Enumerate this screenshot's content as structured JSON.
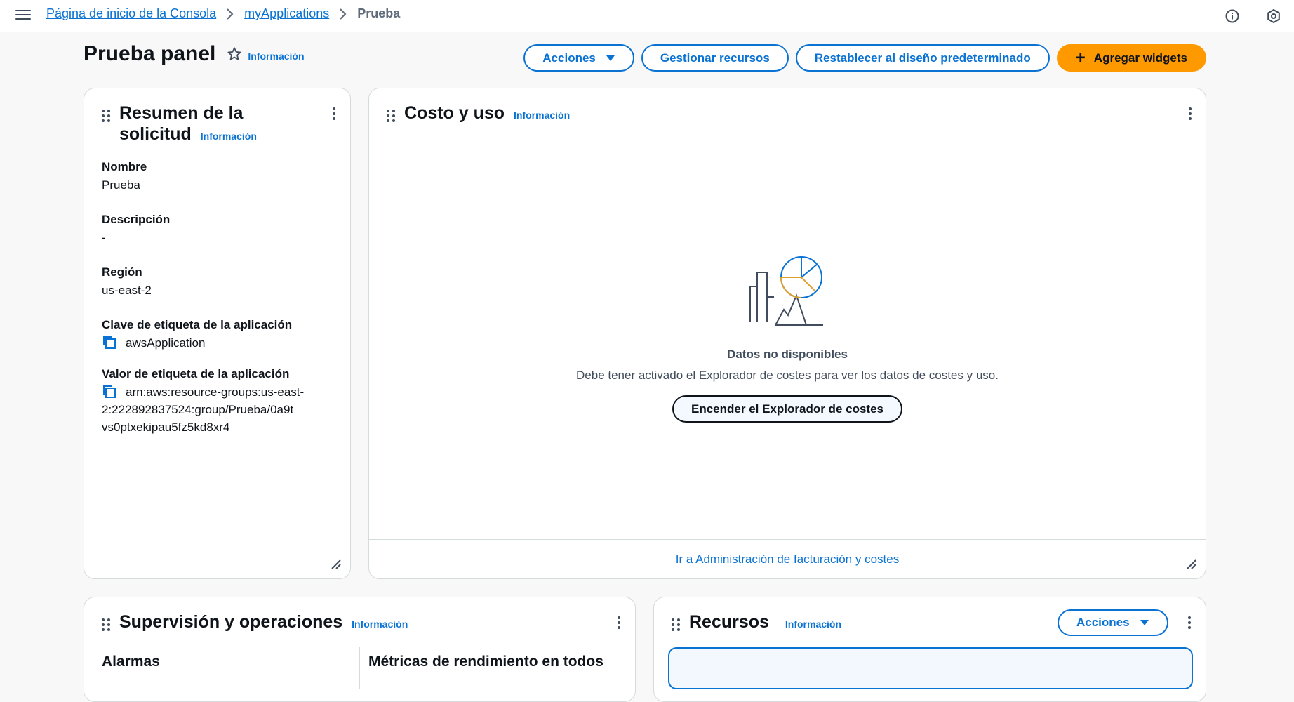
{
  "topbar": {
    "breadcrumbs": [
      "Página de inicio de la Consola",
      "myApplications"
    ],
    "current": "Prueba",
    "icons": [
      "menu-icon",
      "info-icon",
      "settings-icon"
    ]
  },
  "header": {
    "title": "Prueba panel",
    "info": "Información",
    "actions_label": "Acciones",
    "manage_label": "Gestionar recursos",
    "reset_label": "Restablecer al diseño predeterminado",
    "add_widgets_label": "Agregar widgets"
  },
  "summary": {
    "title_line1": "Resumen de la",
    "title_line2": "solicitud",
    "info": "Información",
    "name_label": "Nombre",
    "name_value": "Prueba",
    "desc_label": "Descripción",
    "desc_value": "-",
    "region_label": "Región",
    "region_value": "us-east-2",
    "tag_key_label": "Clave de etiqueta de la aplicación",
    "tag_key_value": "awsApplication",
    "tag_value_label": "Valor de etiqueta de la aplicación",
    "tag_value_line1": "arn:aws:resource-groups:us-east-",
    "tag_value_line2": "2:222892837524:group/Prueba/0a9t",
    "tag_value_line3": "vs0ptxekipau5fz5kd8xr4"
  },
  "cost": {
    "title": "Costo y uso",
    "info": "Información",
    "empty_title": "Datos no disponibles",
    "empty_desc": "Debe tener activado el Explorador de costes para ver los datos de costes y uso.",
    "enable_label": "Encender el Explorador de costes",
    "footer_link": "Ir a Administración de facturación y costes"
  },
  "monitoring": {
    "title": "Supervisión y operaciones",
    "info": "Información",
    "col1": "Alarmas",
    "col2": "Métricas de rendimiento en todos"
  },
  "resources": {
    "title": "Recursos",
    "info": "Información",
    "actions_label": "Acciones"
  },
  "colors": {
    "link": "#0972d3",
    "primary": "#ff9900",
    "text": "#0f141a",
    "border": "#d5dbdb"
  }
}
